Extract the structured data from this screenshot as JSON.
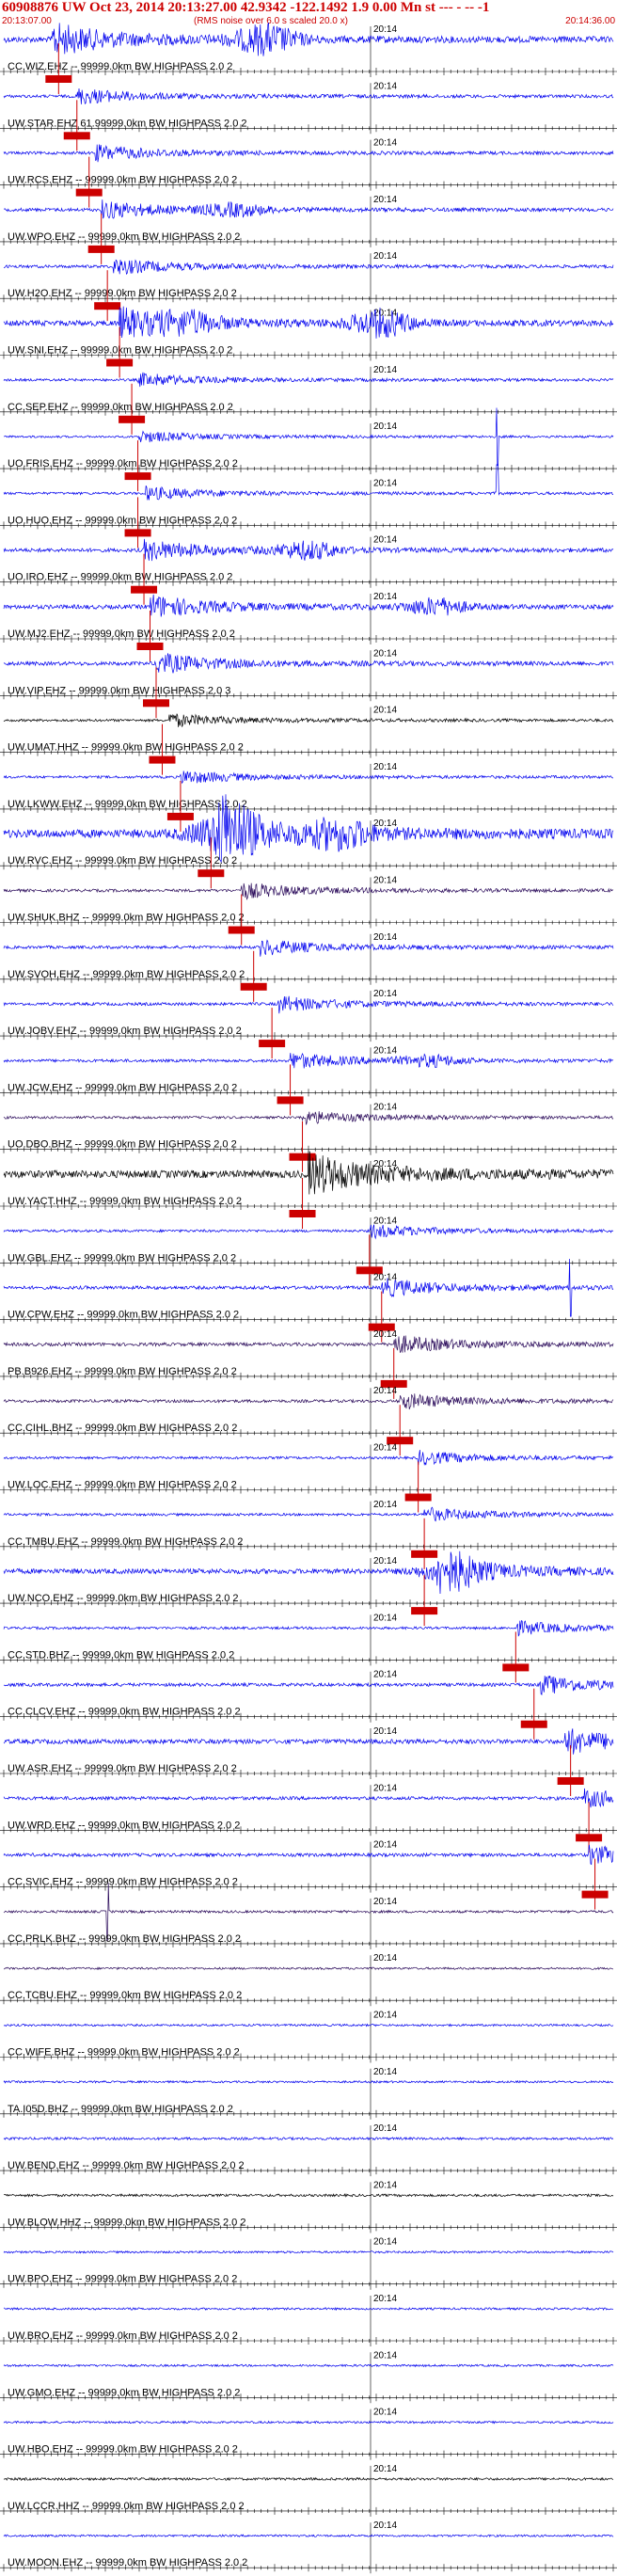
{
  "header": {
    "title": "60908876 UW Oct 23, 2014 20:13:27.00   42.9342 -122.1492  1.9 0.00 Mn st --- - --  -1",
    "start_time": "20:13:07.00",
    "note": "(RMS noise over 6.0 s scaled 20.0 x)",
    "end_time": "20:14:36.00",
    "minute_label": "20:14"
  },
  "colors": {
    "trace_blue": "#0000ee",
    "trace_black": "#000000",
    "trace_purple": "#2a0a5a",
    "pick_red": "#cc0000",
    "label": "#000000",
    "tick": "#000000"
  },
  "chart_data": {
    "type": "line",
    "title": "60908876 UW Oct 23, 2014 20:13:27.00   42.9342 -122.1492  1.9 0.00 Mn st --- - --  -1",
    "x_unit": "time",
    "x_range": [
      "20:13:07.00",
      "20:14:36.00"
    ],
    "minute_mark": "20:14",
    "grid": false,
    "series": [
      {
        "name": "CC.WIZ.EHZ -- 99999.0km BW  HIGHPASS  2.0  2",
        "color": "blue",
        "amp": 14,
        "event": 0.08,
        "extra": [
          [
            0.43,
            1.0
          ]
        ],
        "pick": 0.09
      },
      {
        "name": "UW.STAR.EHZ 61.99999.0km BW  HIGHPASS  2.0  2",
        "color": "blue",
        "amp": 7,
        "event": 0.12,
        "pick": 0.12
      },
      {
        "name": "UW.RCS.EHZ -- 99999.0km BW  HIGHPASS  2.0  2",
        "color": "blue",
        "amp": 7,
        "event": 0.15,
        "pick": 0.14
      },
      {
        "name": "UW.WPO.EHZ -- 99999.0km BW  HIGHPASS  2.0  2",
        "color": "blue",
        "amp": 8,
        "event": 0.16,
        "extra": [
          [
            0.38,
            0.7
          ]
        ],
        "pick": 0.16
      },
      {
        "name": "UW.H2O.EHZ -- 99999.0km BW  HIGHPASS  2.0  2",
        "color": "blue",
        "amp": 7,
        "event": 0.18,
        "pick": 0.17
      },
      {
        "name": "UW.SNI.EHZ -- 99999.0km BW  HIGHPASS  2.0  2",
        "color": "blue",
        "amp": 13,
        "event": 0.19,
        "extra": [
          [
            0.3,
            0.6
          ],
          [
            0.62,
            1.0
          ]
        ],
        "pick": 0.19
      },
      {
        "name": "CC.SEP.EHZ -- 99999.0km BW  HIGHPASS  2.0  2",
        "color": "blue",
        "amp": 6,
        "event": 0.22,
        "pick": 0.21
      },
      {
        "name": "UO.FRIS.EHZ -- 99999.0km BW  HIGHPASS  2.0  2",
        "color": "blue",
        "amp": 5,
        "event": 0.22,
        "spike": [
          0.81,
          0.9
        ],
        "pick": 0.22
      },
      {
        "name": "UO.HUO.EHZ -- 99999.0km BW  HIGHPASS  2.0  2",
        "color": "blue",
        "amp": 6,
        "event": 0.23,
        "spike": [
          0.81,
          0.9
        ],
        "pick": 0.22
      },
      {
        "name": "UO.IRO.EHZ -- 99999.0km BW  HIGHPASS  2.0  2",
        "color": "blue",
        "amp": 9,
        "event": 0.23,
        "extra": [
          [
            0.5,
            0.9
          ]
        ],
        "pick": 0.23
      },
      {
        "name": "UW.MJ2.EHZ -- 99999.0km BW  HIGHPASS  2.0  2",
        "color": "blue",
        "amp": 10,
        "event": 0.24,
        "extra": [
          [
            0.71,
            0.8
          ]
        ],
        "pick": 0.24
      },
      {
        "name": "UW.VIP.EHZ -- 99999.0km BW  HIGHPASS  2.0  3",
        "color": "blue",
        "amp": 9,
        "event": 0.25,
        "pick": 0.25
      },
      {
        "name": "UW.UMAT.HHZ -- 99999.0km BW  HIGHPASS  2.0  2",
        "color": "black",
        "amp": 6,
        "event": 0.27,
        "pick": 0.26
      },
      {
        "name": "UW.LKWW.EHZ -- 99999.0km BW  HIGHPASS  2.0  2",
        "color": "blue",
        "amp": 6,
        "event": 0.29,
        "pick": 0.29
      },
      {
        "name": "UW.RVC.EHZ -- 99999.0km BW  HIGHPASS  2.0  2",
        "color": "blue",
        "amp": 20,
        "event": 0.35,
        "extra": [
          [
            0.36,
            1.0
          ],
          [
            0.55,
            0.6
          ]
        ],
        "pick": 0.34
      },
      {
        "name": "UW.SHUK.BHZ -- 99999.0km BW  HIGHPASS  2.0  2",
        "color": "purple",
        "amp": 7,
        "event": 0.39,
        "pick": 0.39
      },
      {
        "name": "UW.SVOH.EHZ -- 99999.0km BW  HIGHPASS  2.0  2",
        "color": "blue",
        "amp": 7,
        "event": 0.42,
        "pick": 0.41
      },
      {
        "name": "UW.JOBV.EHZ -- 99999.0km BW  HIGHPASS  2.0  2",
        "color": "blue",
        "amp": 7,
        "event": 0.45,
        "pick": 0.44
      },
      {
        "name": "UW.JCW.EHZ -- 99999.0km BW  HIGHPASS  2.0  2",
        "color": "blue",
        "amp": 7,
        "event": 0.47,
        "extra": [
          [
            0.7,
            0.7
          ]
        ],
        "pick": 0.47
      },
      {
        "name": "UO.DBO.BHZ -- 99999.0km BW  HIGHPASS  2.0  2",
        "color": "purple",
        "amp": 6,
        "event": 0.49,
        "pick": 0.49
      },
      {
        "name": "UW.YACT.HHZ -- 99999.0km BW  HIGHPASS  2.0  2",
        "color": "black",
        "amp": 18,
        "event": 0.5,
        "pick": 0.49
      },
      {
        "name": "UW.GBL.EHZ -- 99999.0km BW  HIGHPASS  2.0  2",
        "color": "blue",
        "amp": 6,
        "event": 0.6,
        "pick": 0.6
      },
      {
        "name": "UW.CPW.EHZ -- 99999.0km BW  HIGHPASS  2.0  2",
        "color": "blue",
        "amp": 8,
        "event": 0.62,
        "spike": [
          0.93,
          0.9
        ],
        "pick": 0.62
      },
      {
        "name": "PB.B926.EHZ -- 99999.0km BW  HIGHPASS  2.0  2",
        "color": "purple",
        "amp": 8,
        "event": 0.64,
        "pick": 0.64
      },
      {
        "name": "CC.CIHL.BHZ -- 99999.0km BW  HIGHPASS  2.0  2",
        "color": "purple",
        "amp": 7,
        "event": 0.65,
        "pick": 0.65
      },
      {
        "name": "UW.LOC.EHZ -- 99999.0km BW  HIGHPASS  2.0  2",
        "color": "blue",
        "amp": 6,
        "event": 0.68,
        "pick": 0.68
      },
      {
        "name": "CC.TMBU.EHZ -- 99999.0km BW  HIGHPASS  2.0  2",
        "color": "blue",
        "amp": 6,
        "event": 0.69,
        "pick": 0.69
      },
      {
        "name": "UW.NCO.EHZ -- 99999.0km BW  HIGHPASS  2.0  2",
        "color": "blue",
        "amp": 12,
        "event": 0.71,
        "extra": [
          [
            0.73,
            0.9
          ]
        ],
        "pick": 0.69
      },
      {
        "name": "CC.STD.BHZ -- 99999.0km BW  HIGHPASS  2.0  2",
        "color": "blue",
        "amp": 6,
        "event": 0.84,
        "pick": 0.84
      },
      {
        "name": "CC.CLCV.EHZ -- 99999.0km BW  HIGHPASS  2.0  2",
        "color": "blue",
        "amp": 8,
        "event": 0.88,
        "pick": 0.87
      },
      {
        "name": "UW.ASR.EHZ -- 99999.0km BW  HIGHPASS  2.0  2",
        "color": "blue",
        "amp": 11,
        "event": 0.92,
        "pick": 0.93
      },
      {
        "name": "UW.WRD.EHZ -- 99999.0km BW  HIGHPASS  2.0  2",
        "color": "blue",
        "amp": 8,
        "event": 0.95,
        "pick": 0.96
      },
      {
        "name": "CC.SVIC.EHZ -- 99999.0km BW  HIGHPASS  2.0  2",
        "color": "blue",
        "amp": 8,
        "event": 0.96,
        "pick": 0.97
      },
      {
        "name": "CC.PRLK.BHZ -- 99999.0km BW  HIGHPASS  2.0  2",
        "color": "purple",
        "amp": 6,
        "spike": [
          0.17,
          0.9
        ]
      },
      {
        "name": "CC.TCBU.EHZ -- 99999.0km BW  HIGHPASS  2.0  2",
        "color": "purple",
        "amp": 5
      },
      {
        "name": "CC.WIFE.BHZ -- 99999.0km BW  HIGHPASS  2.0  2",
        "color": "blue",
        "amp": 5
      },
      {
        "name": "TA.I05D.BHZ -- 99999.0km BW  HIGHPASS  2.0  2",
        "color": "blue",
        "amp": 5
      },
      {
        "name": "UW.BEND.EHZ -- 99999.0km BW  HIGHPASS  2.0  2",
        "color": "blue",
        "amp": 6
      },
      {
        "name": "UW.BLOW.HHZ -- 99999.0km BW  HIGHPASS  2.0  2",
        "color": "black",
        "amp": 6
      },
      {
        "name": "UW.BPO.EHZ -- 99999.0km BW  HIGHPASS  2.0  2",
        "color": "blue",
        "amp": 5
      },
      {
        "name": "UW.BRO.EHZ -- 99999.0km BW  HIGHPASS  2.0  2",
        "color": "blue",
        "amp": 5
      },
      {
        "name": "UW.GMO.EHZ -- 99999.0km BW  HIGHPASS  2.0  2",
        "color": "blue",
        "amp": 5
      },
      {
        "name": "UW.HBO.EHZ -- 99999.0km BW  HIGHPASS  2.0  2",
        "color": "blue",
        "amp": 5
      },
      {
        "name": "UW.LCCR.HHZ -- 99999.0km BW  HIGHPASS  2.0  2",
        "color": "black",
        "amp": 6
      },
      {
        "name": "UW.MOON.EHZ -- 99999.0km BW  HIGHPASS  2.0  2",
        "color": "blue",
        "amp": 5
      }
    ]
  }
}
